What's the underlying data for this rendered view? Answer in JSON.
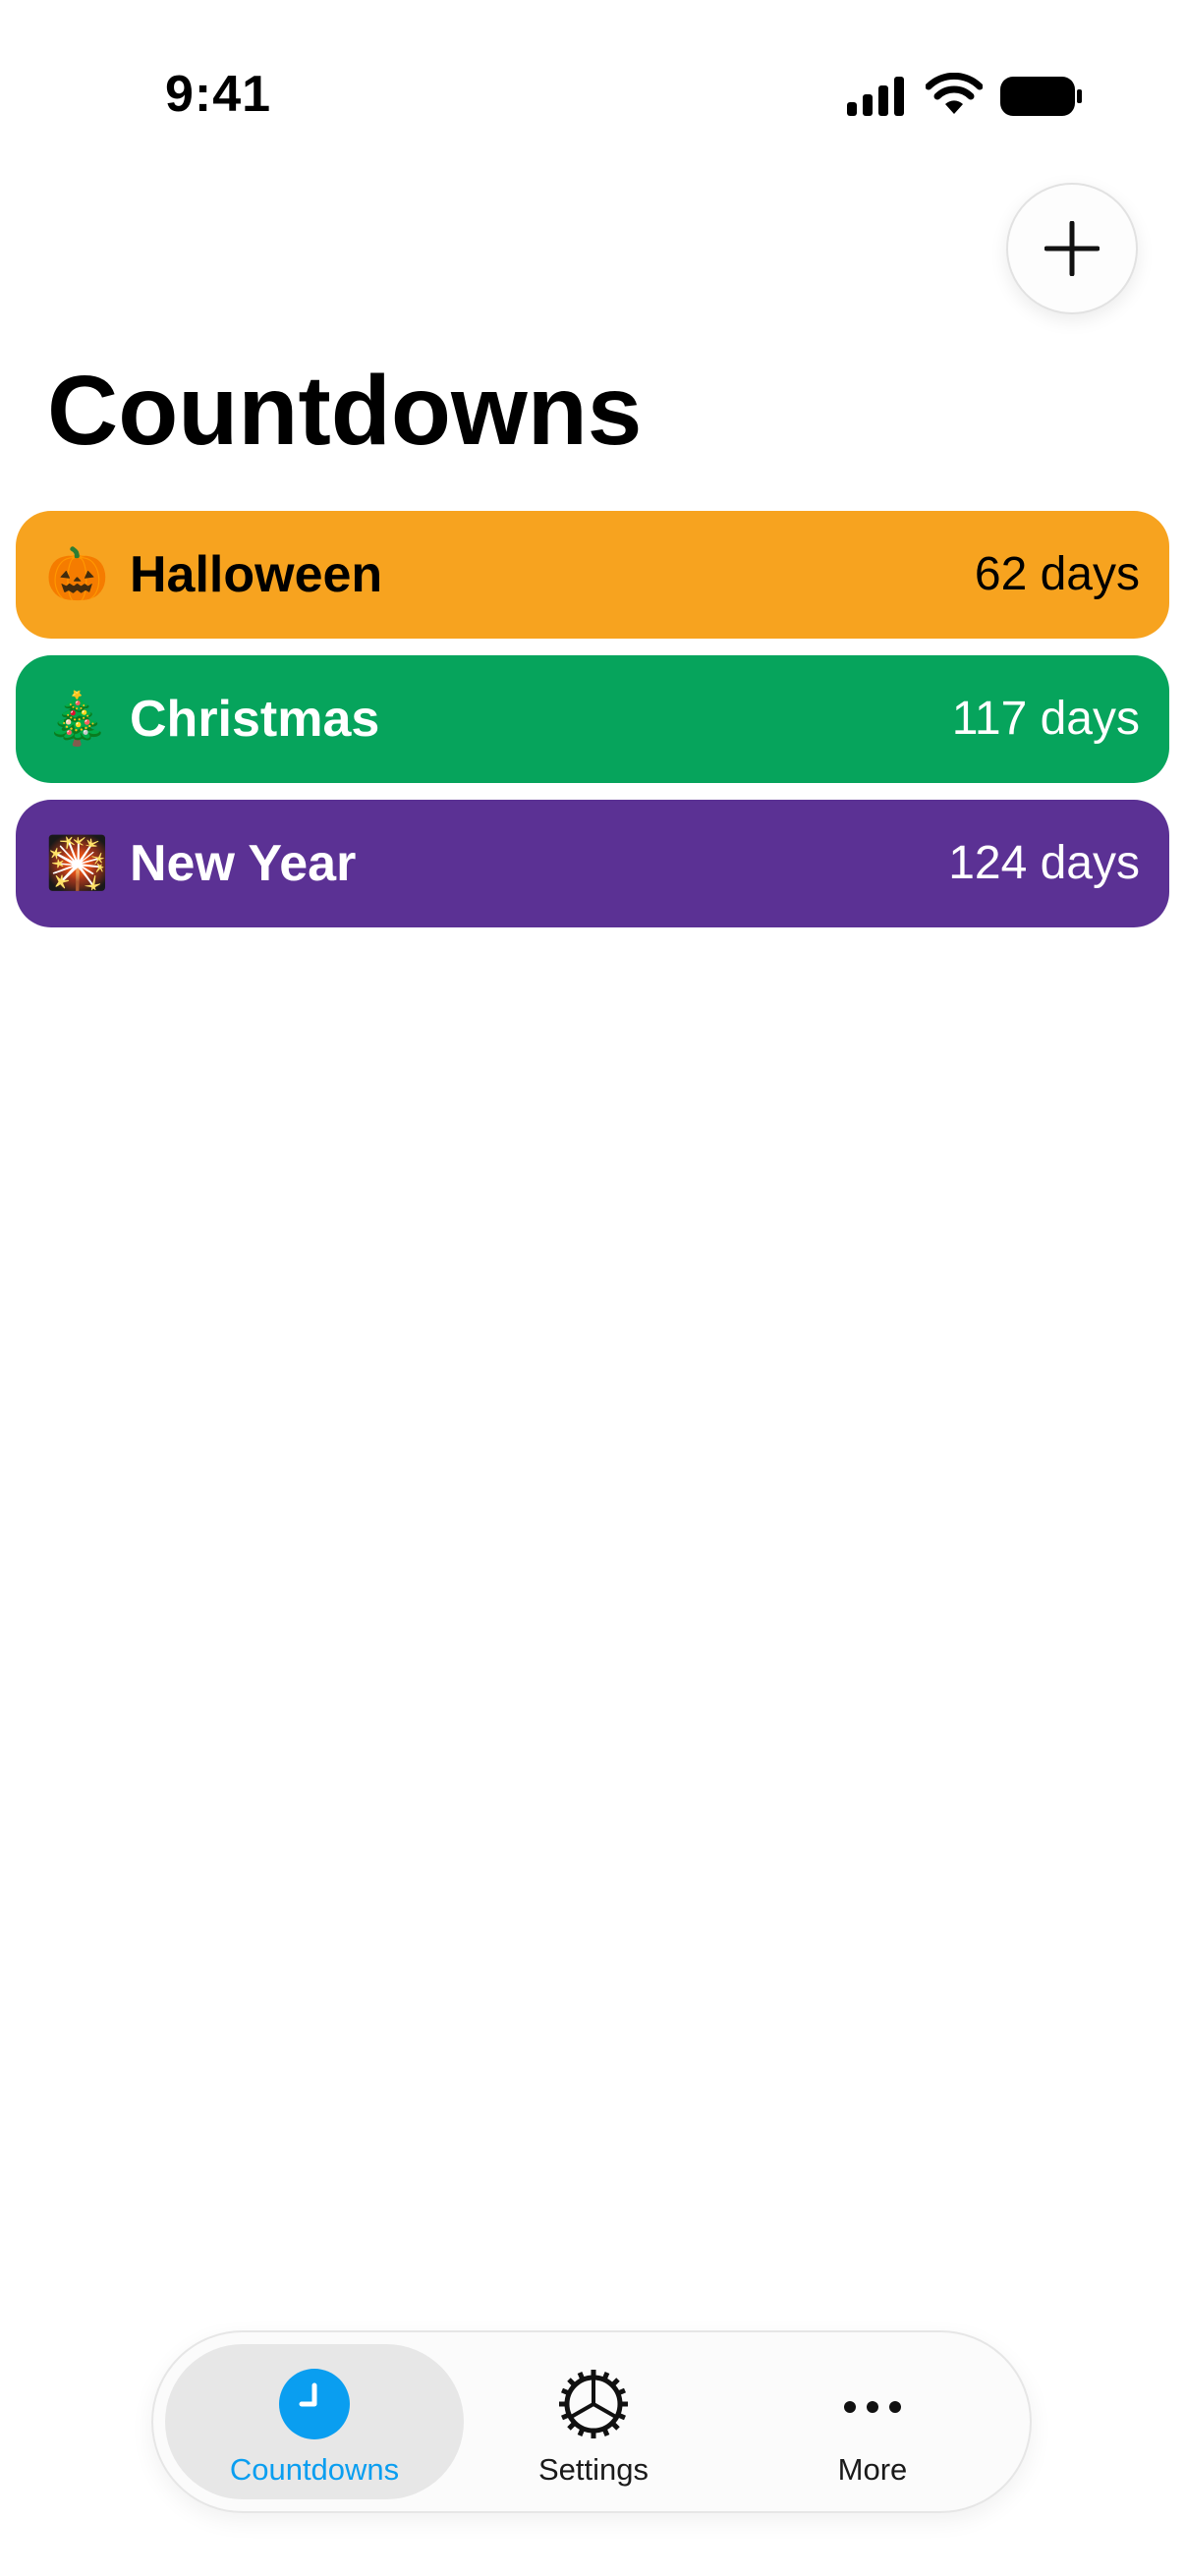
{
  "status_bar": {
    "time": "9:41",
    "icons": [
      "cellular-signal-icon",
      "wifi-icon",
      "battery-icon"
    ]
  },
  "header": {
    "add_icon": "plus-icon"
  },
  "page": {
    "title": "Countdowns"
  },
  "countdowns": [
    {
      "emoji": "🎃",
      "name": "Halloween",
      "days": "62 days",
      "color": "#F7A31F",
      "text_color": "#000000"
    },
    {
      "emoji": "🎄",
      "name": "Christmas",
      "days": "117 days",
      "color": "#06A45C",
      "text_color": "#FFFFFF"
    },
    {
      "emoji": "🎇",
      "name": "New Year",
      "days": "124 days",
      "color": "#5B3194",
      "text_color": "#FFFFFF"
    }
  ],
  "tabbar": {
    "tabs": [
      {
        "label": "Countdowns",
        "icon": "clock-icon",
        "active": true
      },
      {
        "label": "Settings",
        "icon": "gear-icon",
        "active": false
      },
      {
        "label": "More",
        "icon": "ellipsis-icon",
        "active": false
      }
    ],
    "active_color": "#0A9EF0"
  }
}
